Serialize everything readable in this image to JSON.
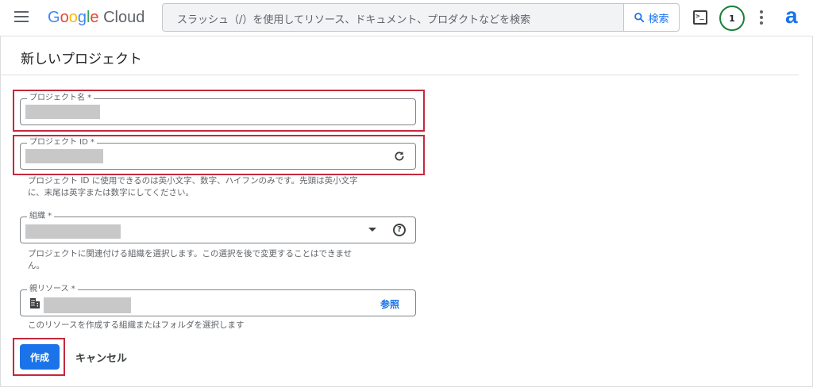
{
  "header": {
    "logo_google": [
      "G",
      "o",
      "o",
      "g",
      "l",
      "e"
    ],
    "logo_cloud": "Cloud",
    "search_placeholder": "スラッシュ（/）を使用してリソース、ドキュメント、プロダクトなどを検索",
    "search_button": "検索",
    "terminal_glyph": ">_",
    "notification_count": "1",
    "account_glyph": "a"
  },
  "page": {
    "title": "新しいプロジェクト"
  },
  "form": {
    "project_name": {
      "label": "プロジェクト名 *"
    },
    "project_id": {
      "label": "プロジェクト ID *",
      "hint_line1": "プロジェクト ID に使用できるのは英小文字、数字、ハイフンのみです。先頭は英小文字",
      "hint_line2": "に、末尾は英字または数字にしてください。"
    },
    "organization": {
      "label": "組織 *",
      "help_glyph": "?",
      "hint_line1": "プロジェクトに関連付ける組織を選択します。この選択を後で変更することはできませ",
      "hint_line2": "ん。"
    },
    "parent_resource": {
      "label": "親リソース *",
      "browse_label": "参照",
      "hint": "このリソースを作成する組織またはフォルダを選択します"
    },
    "create_label": "作成",
    "cancel_label": "キャンセル"
  },
  "colors": {
    "primary": "#1a73e8",
    "highlight": "#c5283d",
    "notification_ring": "#188038"
  }
}
